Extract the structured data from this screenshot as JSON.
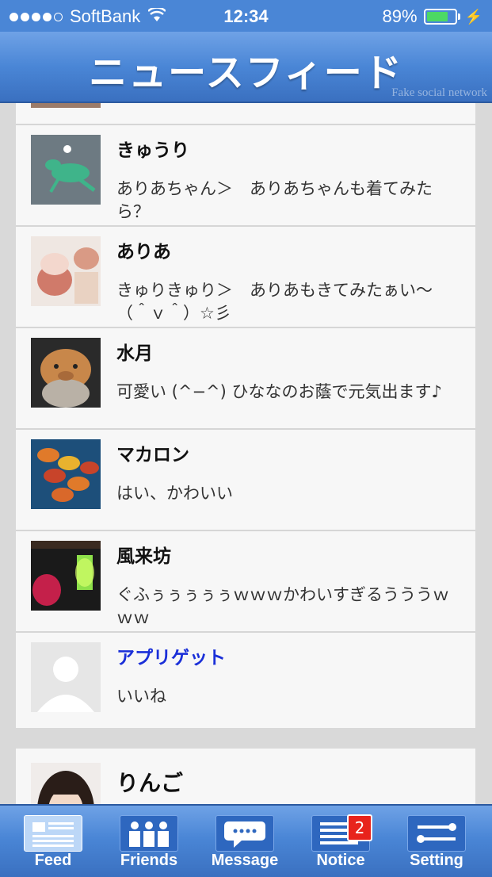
{
  "status_bar": {
    "carrier": "SoftBank",
    "time": "12:34",
    "battery": "89%",
    "battery_level": 0.89
  },
  "nav": {
    "title": "ニュースフィード",
    "subtitle": "Fake social network"
  },
  "feed": {
    "comments": [
      {
        "name": "きゅうり",
        "message": "ありあちゃん＞　ありあちゃんも着てみたら？"
      },
      {
        "name": "ありあ",
        "message": "きゅりきゅり＞　ありあもきてみたぁい〜（＾ｖ＾）☆彡"
      },
      {
        "name": "水月",
        "message": "可愛い (^−^) ひななのお蔭で元気出ます♪"
      },
      {
        "name": "マカロン",
        "message": "はい、かわいい"
      },
      {
        "name": "風来坊",
        "message": "ぐふぅぅぅぅぅｗｗｗかわいすぎるうううｗｗｗ"
      },
      {
        "name": "アプリゲット",
        "message": "いいね"
      }
    ],
    "next_post": {
      "name": "りんご"
    }
  },
  "tabbar": {
    "tabs": [
      {
        "label": "Feed",
        "icon": "feed-icon"
      },
      {
        "label": "Friends",
        "icon": "friends-icon"
      },
      {
        "label": "Message",
        "icon": "message-icon"
      },
      {
        "label": "Notice",
        "icon": "notice-icon",
        "badge": "2"
      },
      {
        "label": "Setting",
        "icon": "setting-icon"
      }
    ]
  }
}
